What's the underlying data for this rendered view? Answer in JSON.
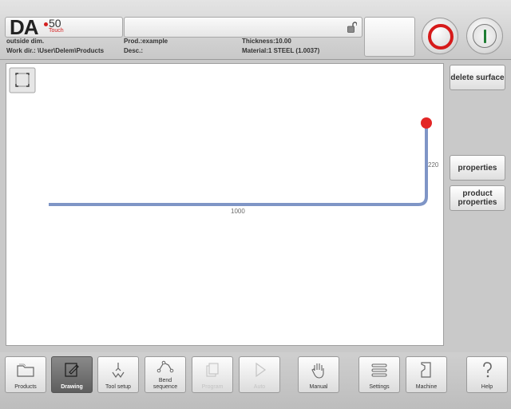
{
  "logo": {
    "brand": "DA",
    "model": "50",
    "variant": "Touch"
  },
  "header": {
    "row1": {
      "col1": "outside dim.",
      "col2": "Prod.:example",
      "col3": "Thickness:10.00"
    },
    "row2": {
      "col1": "Work dir.: \\User\\Delem\\Products",
      "col2": "Desc.:",
      "col3": "Material:1 STEEL (1.0037)"
    }
  },
  "icons": {
    "lock": "unlocked-padlock-icon",
    "zoom": "fullscreen-frame-icon",
    "stop": "stop-icon",
    "start": "start-icon"
  },
  "colors": {
    "profile": "#7f95c6",
    "endpoint": "#e32626",
    "stop": "#d61a1a",
    "start": "#1e7d33"
  },
  "drawing": {
    "dim_bottom": "1000",
    "dim_right": "220"
  },
  "sidebar": {
    "delete_surface": "delete surface",
    "properties": "properties",
    "product_properties": "product properties"
  },
  "nav": [
    {
      "label": "Products",
      "icon": "folder-icon",
      "state": "normal"
    },
    {
      "label": "Drawing",
      "icon": "drawing-icon",
      "state": "active"
    },
    {
      "label": "Tool setup",
      "icon": "tool-setup-icon",
      "state": "normal"
    },
    {
      "label": "Bend sequence",
      "icon": "bend-sequence-icon",
      "state": "normal"
    },
    {
      "label": "Program",
      "icon": "program-icon",
      "state": "disabled"
    },
    {
      "label": "Auto",
      "icon": "play-icon",
      "state": "disabled"
    },
    {
      "label": "Manual",
      "icon": "hand-icon",
      "state": "normal"
    },
    {
      "label": "Settings",
      "icon": "settings-icon",
      "state": "normal"
    },
    {
      "label": "Machine",
      "icon": "machine-icon",
      "state": "normal"
    },
    {
      "label": "Help",
      "icon": "question-icon",
      "state": "normal"
    }
  ]
}
